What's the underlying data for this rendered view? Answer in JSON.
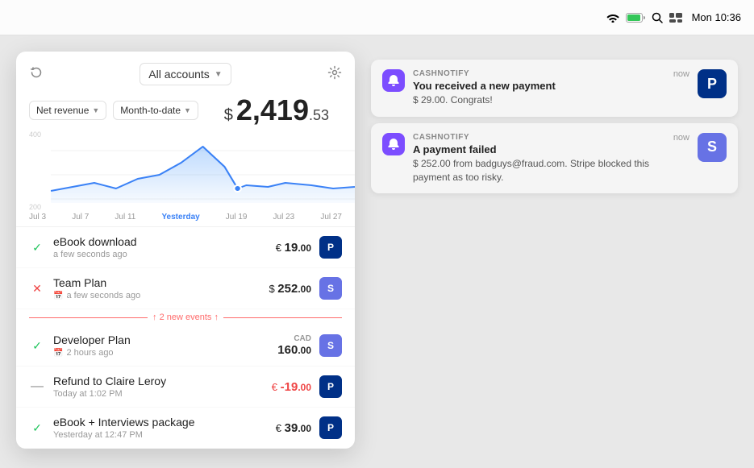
{
  "topbar": {
    "time": "Mon 10:36",
    "wifi_icon": "wifi",
    "battery_icon": "battery",
    "search_icon": "search",
    "notification_icon": "notification"
  },
  "widget": {
    "accounts_dropdown": "All accounts",
    "revenue_filter": "Net revenue",
    "date_filter": "Month-to-date",
    "amount_symbol": "$",
    "amount_main": "2,419",
    "amount_cents": ".53",
    "chart_labels": [
      "Jul 3",
      "Jul 7",
      "Jul 11",
      "Yesterday",
      "Jul 19",
      "Jul 23",
      "Jul 27"
    ],
    "chart_y_labels": [
      "400",
      "200"
    ],
    "transactions": [
      {
        "status": "success",
        "name": "eBook download",
        "time": "a few seconds ago",
        "has_calendar": false,
        "currency": "€",
        "amount": "19",
        "cents": ".00",
        "currency_label": "",
        "negative": false,
        "payment": "paypal"
      },
      {
        "status": "error",
        "name": "Team Plan",
        "time": "a few seconds ago",
        "has_calendar": true,
        "currency": "$",
        "amount": "252",
        "cents": ".00",
        "currency_label": "",
        "negative": false,
        "payment": "stripe"
      },
      {
        "status": "success",
        "name": "Developer Plan",
        "time": "2 hours ago",
        "has_calendar": true,
        "currency": "CAD",
        "amount": "160",
        "cents": ".00",
        "currency_label": "CAD",
        "negative": false,
        "payment": "stripe"
      },
      {
        "status": "refund",
        "name": "Refund to Claire Leroy",
        "time": "Today at 1:02 PM",
        "has_calendar": false,
        "currency": "€",
        "amount": "-19",
        "cents": ".00",
        "currency_label": "",
        "negative": true,
        "payment": "paypal"
      },
      {
        "status": "success",
        "name": "eBook + Interviews package",
        "time": "Yesterday at 12:47 PM",
        "has_calendar": false,
        "currency": "€",
        "amount": "39",
        "cents": ".00",
        "currency_label": "",
        "negative": false,
        "payment": "paypal"
      }
    ],
    "new_events_text": "↑ 2 new events ↑"
  },
  "notifications": [
    {
      "app": "CASHNOTIFY",
      "time": "now",
      "title": "You received a new payment",
      "body": "$ 29.00. Congrats!",
      "type": "paypal"
    },
    {
      "app": "CASHNOTIFY",
      "time": "now",
      "title": "A payment failed",
      "body": "$ 252.00 from badguys@fraud.com. Stripe blocked this payment as too risky.",
      "type": "stripe"
    }
  ]
}
